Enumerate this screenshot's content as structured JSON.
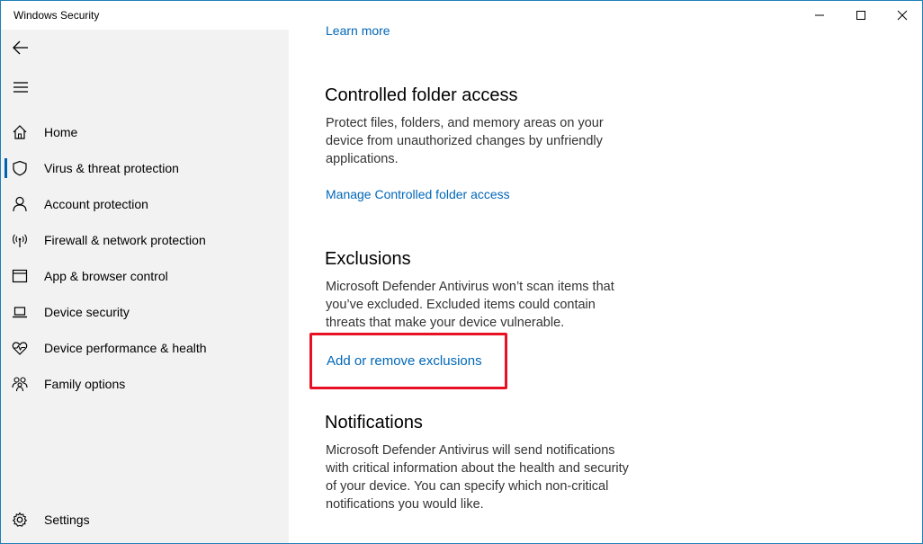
{
  "window": {
    "title": "Windows Security"
  },
  "sidebar": {
    "items": [
      {
        "label": "Home",
        "icon": "home-icon"
      },
      {
        "label": "Virus & threat protection",
        "icon": "shield-icon",
        "selected": true
      },
      {
        "label": "Account protection",
        "icon": "person-icon"
      },
      {
        "label": "Firewall & network protection",
        "icon": "wifi-antenna-icon"
      },
      {
        "label": "App & browser control",
        "icon": "app-window-icon"
      },
      {
        "label": "Device security",
        "icon": "laptop-icon"
      },
      {
        "label": "Device performance & health",
        "icon": "heart-pulse-icon"
      },
      {
        "label": "Family options",
        "icon": "family-icon"
      }
    ],
    "settings_label": "Settings"
  },
  "main": {
    "learn_more": "Learn more",
    "controlled_folder": {
      "title": "Controlled folder access",
      "body": "Protect files, folders, and memory areas on your device from unauthorized changes by unfriendly applications.",
      "link": "Manage Controlled folder access"
    },
    "exclusions": {
      "title": "Exclusions",
      "body": "Microsoft Defender Antivirus won’t scan items that you’ve excluded. Excluded items could contain threats that make your device vulnerable.",
      "link": "Add or remove exclusions"
    },
    "notifications": {
      "title": "Notifications",
      "body": "Microsoft Defender Antivirus will send notifications with critical information about the health and security of your device. You can specify which non-critical notifications you would like."
    }
  },
  "colors": {
    "accent": "#0067b8",
    "highlight": "#e81123",
    "sidebar_bg": "#f2f2f2"
  }
}
